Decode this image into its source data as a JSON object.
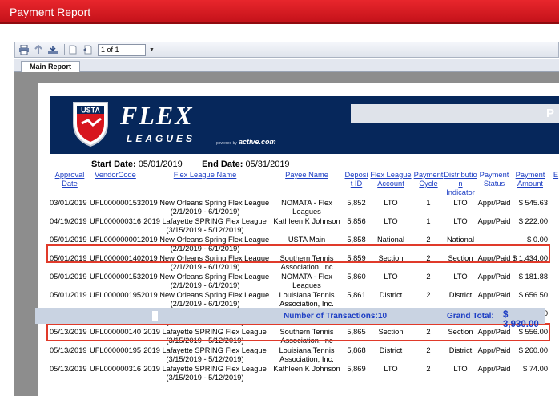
{
  "window": {
    "title": "Payment Report"
  },
  "toolbar": {
    "page_value": "1 of 1"
  },
  "tabs": [
    {
      "label": "Main Report"
    }
  ],
  "banner": {
    "brand_usta": "USTA",
    "brand_flex": "FLEX",
    "brand_leagues": "LEAGUES",
    "powered_by": "powered by",
    "active": "active.com",
    "right_letter": "P"
  },
  "report": {
    "start_label": "Start Date:",
    "start_value": "05/01/2019",
    "end_label": "End Date:",
    "end_value": "05/31/2019"
  },
  "columns": [
    "Approval Date",
    "VendorCode",
    "Flex League Name",
    "Payee Name",
    "Deposit ID",
    "Flex League Account",
    "Payment Cycle",
    "Distribution Indicator",
    "Payment Status",
    "Payment Amount",
    "E"
  ],
  "rows": [
    [
      "03/01/2019",
      "UFL000000153",
      "2019 New Orleans Spring Flex League",
      "(2/1/2019 - 6/1/2019)",
      "NOMATA - Flex",
      "Leagues",
      "5,852",
      "LTO",
      "1",
      "LTO",
      "Appr/Paid",
      "$ 545.63"
    ],
    [
      "04/19/2019",
      "UFL000000316",
      "2019 Lafayette SPRING Flex League",
      "(3/15/2019 - 5/12/2019)",
      "Kathleen K Johnson",
      "",
      "5,856",
      "LTO",
      "1",
      "LTO",
      "Appr/Paid",
      "$ 222.00"
    ],
    [
      "05/01/2019",
      "UFL000000001",
      "2019 New Orleans Spring Flex League",
      "(2/1/2019 - 6/1/2019)",
      "USTA Main",
      "",
      "5,858",
      "National",
      "2",
      "National",
      "",
      "$ 0.00"
    ],
    [
      "05/01/2019",
      "UFL000000140",
      "2019 New Orleans Spring Flex League",
      "(2/1/2019 - 6/1/2019)",
      "Southern Tennis",
      "Association, Inc",
      "5,859",
      "Section",
      "2",
      "Section",
      "Appr/Paid",
      "$ 1,434.00"
    ],
    [
      "05/01/2019",
      "UFL000000153",
      "2019 New Orleans Spring Flex League",
      "(2/1/2019 - 6/1/2019)",
      "NOMATA - Flex",
      "Leagues",
      "5,860",
      "LTO",
      "2",
      "LTO",
      "Appr/Paid",
      "$ 181.88"
    ],
    [
      "05/01/2019",
      "UFL000000195",
      "2019 New Orleans Spring Flex League",
      "(2/1/2019 - 6/1/2019)",
      "Louisiana Tennis",
      "Association, Inc.",
      "5,861",
      "District",
      "2",
      "District",
      "Appr/Paid",
      "$ 656.50"
    ],
    [
      "05/13/2019",
      "UFL000000001",
      "2019 Lafayette SPRING Flex League",
      "(3/15/2019 - 5/12/2019)",
      "USTA Main",
      "",
      "5,863",
      "National",
      "2",
      "National",
      "",
      "$ 0.00"
    ],
    [
      "05/13/2019",
      "UFL000000140",
      "2019 Lafayette SPRING Flex League",
      "(3/15/2019 - 5/12/2019)",
      "Southern Tennis",
      "Association, Inc",
      "5,865",
      "Section",
      "2",
      "Section",
      "Appr/Paid",
      "$ 556.00"
    ],
    [
      "05/13/2019",
      "UFL000000195",
      "2019 Lafayette SPRING Flex League",
      "(3/15/2019 - 5/12/2019)",
      "Louisiana Tennis",
      "Association, Inc.",
      "5,868",
      "District",
      "2",
      "District",
      "Appr/Paid",
      "$ 260.00"
    ],
    [
      "05/13/2019",
      "UFL000000316",
      "2019 Lafayette SPRING Flex League",
      "(3/15/2019 - 5/12/2019)",
      "Kathleen K Johnson",
      "",
      "5,869",
      "LTO",
      "2",
      "LTO",
      "Appr/Paid",
      "$ 74.00"
    ]
  ],
  "footer": {
    "transactions_label": "Number of Transactions:",
    "transactions_value": "10",
    "grand_total_label": "Grand Total:",
    "grand_total_value": "$ 3,930.00"
  },
  "colors": {
    "title_red": "#d7161e",
    "banner_navy": "#06275b",
    "link_blue": "#1d3ec4",
    "highlight": "#e03a2a"
  },
  "icons": [
    "print-icon",
    "export-icon",
    "refresh-icon",
    "first-page-icon",
    "prev-page-icon"
  ]
}
